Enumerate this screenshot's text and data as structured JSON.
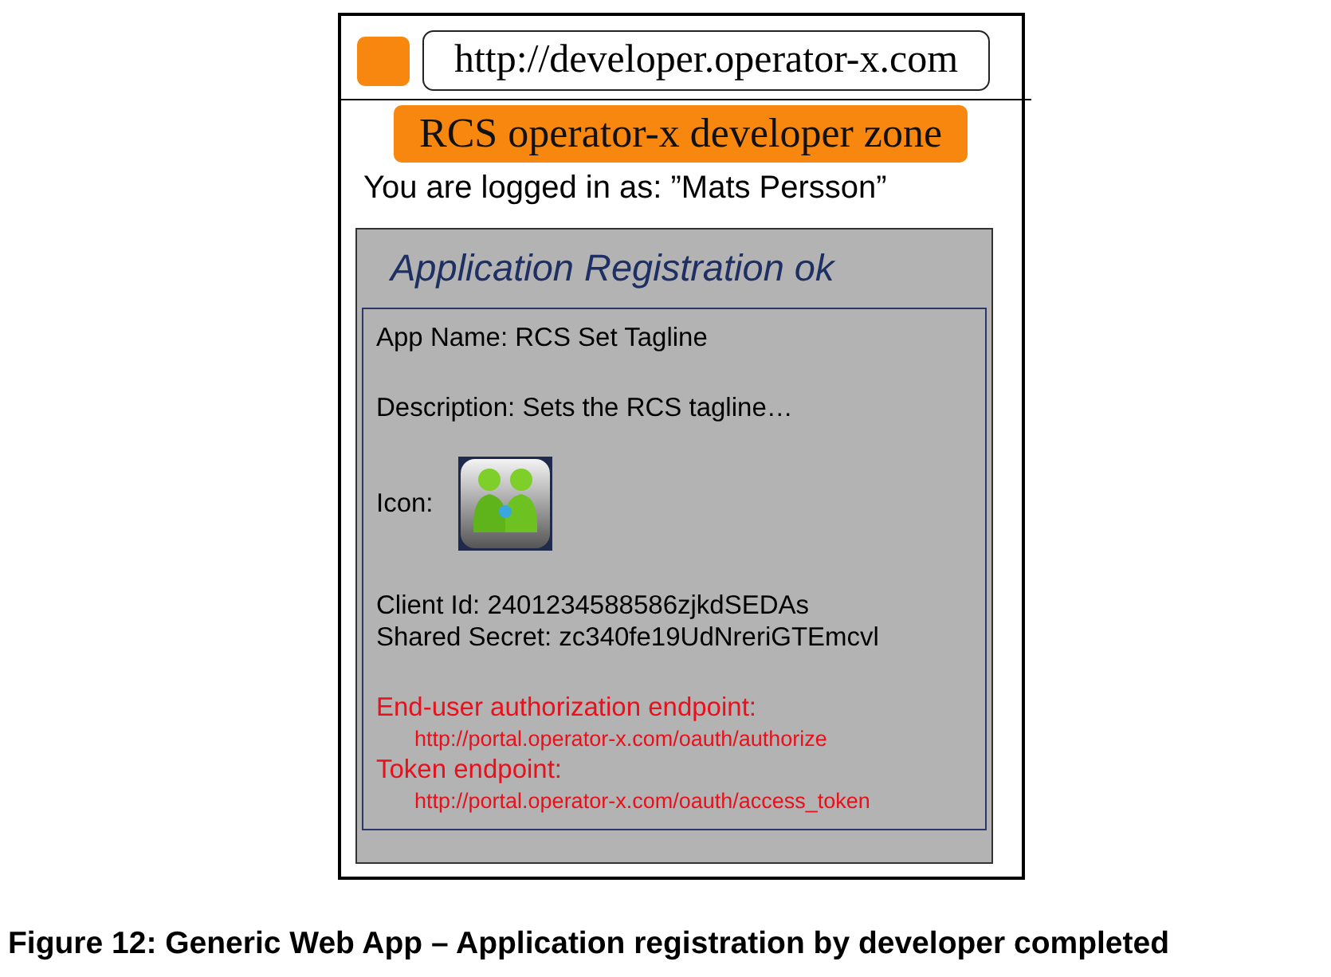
{
  "browser": {
    "address": "http://developer.operator-x.com"
  },
  "banner": "RCS operator-x developer zone",
  "login_status": "You are logged in as: ”Mats Persson”",
  "panel": {
    "title": "Application Registration ok",
    "groups": [
      [
        {
          "kind": "label",
          "text": "App Name: RCS Set Tagline"
        }
      ],
      [
        {
          "kind": "label",
          "text": "Description: Sets the RCS tagline…"
        }
      ],
      [
        {
          "kind": "icon",
          "text": "Icon:"
        }
      ],
      [
        {
          "kind": "label",
          "text": "Client Id: 2401234588586zjkdSEDAs"
        },
        {
          "kind": "label",
          "text": "Shared Secret: zc340fe19UdNreriGTEmcvl"
        }
      ],
      [
        {
          "kind": "endpoint",
          "text": "End-user authorization endpoint:"
        },
        {
          "kind": "url",
          "text": "http://portal.operator-x.com/oauth/authorize"
        },
        {
          "kind": "endpoint",
          "text": "Token endpoint:"
        },
        {
          "kind": "url",
          "text": "http://portal.operator-x.com/oauth/access_token"
        }
      ]
    ]
  },
  "caption": "Figure 12: Generic Web App – Application registration by developer completed"
}
